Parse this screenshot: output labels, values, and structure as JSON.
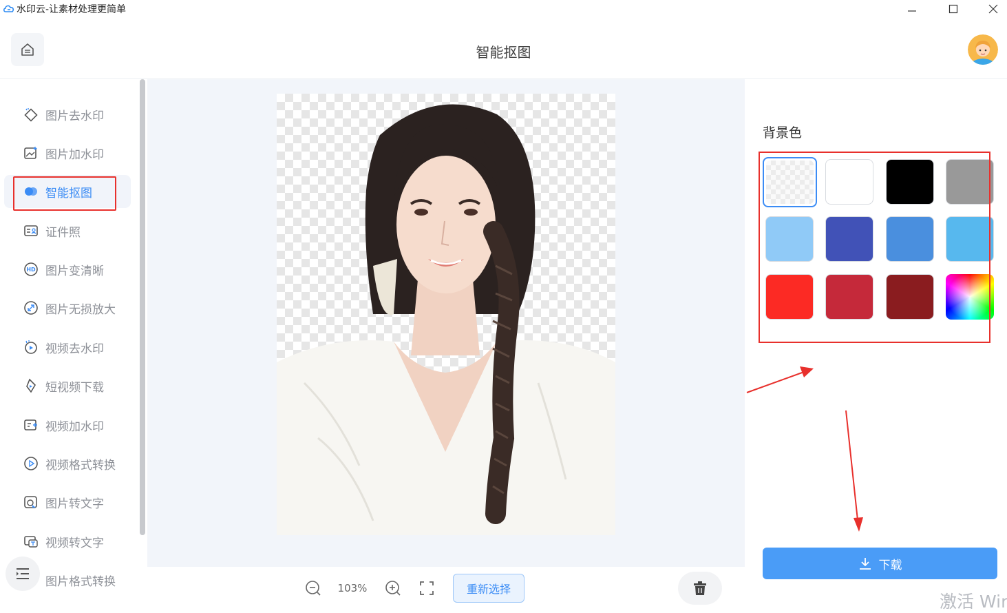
{
  "window": {
    "title": "水印云-让素材处理更简单",
    "minimize_icon": "minimize-icon",
    "maximize_icon": "maximize-icon",
    "close_icon": "close-icon"
  },
  "header": {
    "page_title": "智能抠图",
    "home_icon": "home-icon",
    "avatar": "user-avatar"
  },
  "sidebar": {
    "items": [
      {
        "label": "图片去水印",
        "icon": "eraser-icon"
      },
      {
        "label": "图片加水印",
        "icon": "image-add-icon"
      },
      {
        "label": "智能抠图",
        "icon": "cutout-icon",
        "active": true
      },
      {
        "label": "证件照",
        "icon": "id-card-icon"
      },
      {
        "label": "图片变清晰",
        "icon": "hd-icon"
      },
      {
        "label": "图片无损放大",
        "icon": "enlarge-icon"
      },
      {
        "label": "视频去水印",
        "icon": "video-eraser-icon"
      },
      {
        "label": "短视频下载",
        "icon": "video-download-icon"
      },
      {
        "label": "视频加水印",
        "icon": "video-add-icon"
      },
      {
        "label": "视频格式转换",
        "icon": "play-circle-icon"
      },
      {
        "label": "图片转文字",
        "icon": "image-text-icon"
      },
      {
        "label": "视频转文字",
        "icon": "video-text-icon"
      },
      {
        "label": "图片格式转换",
        "icon": "format-icon"
      }
    ],
    "collapse_icon": "menu-collapse-icon"
  },
  "toolbar": {
    "zoom_level": "103%",
    "reselect_label": "重新选择",
    "zoom_out_icon": "zoom-out-icon",
    "zoom_in_icon": "zoom-in-icon",
    "fit_icon": "fullscreen-icon",
    "delete_icon": "trash-icon"
  },
  "right_panel": {
    "background_label": "背景色",
    "swatches": [
      {
        "name": "transparent",
        "color": "transparent",
        "selected": true
      },
      {
        "name": "white",
        "color": "#ffffff"
      },
      {
        "name": "black",
        "color": "#000000"
      },
      {
        "name": "gray",
        "color": "#999999"
      },
      {
        "name": "light-blue",
        "color": "#90caf7"
      },
      {
        "name": "indigo",
        "color": "#4152b7"
      },
      {
        "name": "mid-blue",
        "color": "#4a8fde"
      },
      {
        "name": "sky-blue",
        "color": "#57b8ee"
      },
      {
        "name": "red",
        "color": "#fc2a24"
      },
      {
        "name": "crimson",
        "color": "#c5293a"
      },
      {
        "name": "dark-red",
        "color": "#8a1c1f"
      },
      {
        "name": "custom",
        "color": "rainbow"
      }
    ],
    "download_label": "下载"
  },
  "watermark_text": "激活 Wir",
  "colors": {
    "accent": "#3b8cf5",
    "download_button": "#4a9cf7",
    "annotation_red": "#e8302c"
  }
}
